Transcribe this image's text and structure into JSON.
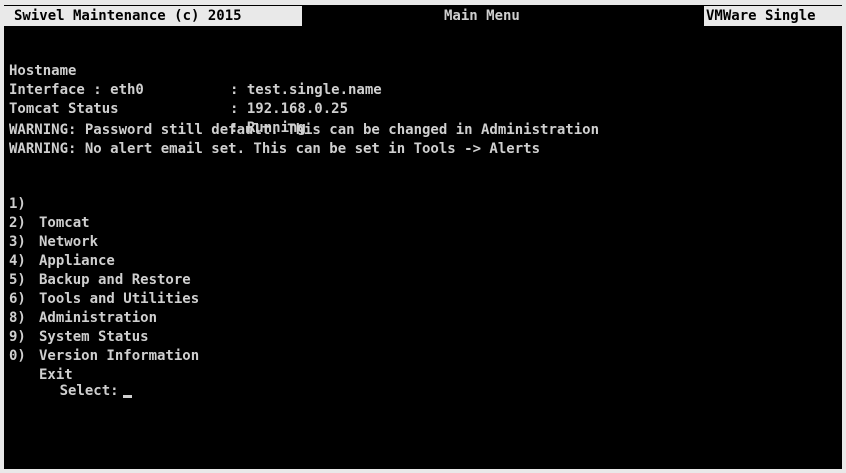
{
  "title_bar": {
    "left": "Swivel Maintenance (c) 2015",
    "center": "Main Menu",
    "right": "VMWare Single"
  },
  "info": [
    {
      "label": "Hostname",
      "value": ": test.single.name"
    },
    {
      "label": "Interface : eth0",
      "value": ": 192.168.0.25"
    },
    {
      "label": "Tomcat Status",
      "value": ": Running"
    }
  ],
  "warnings": [
    "WARNING: Password still default. This can be changed in Administration",
    "WARNING: No alert email set. This can be set in Tools -> Alerts"
  ],
  "menu": [
    {
      "num": "1)",
      "label": "Tomcat"
    },
    {
      "num": "2)",
      "label": "Network"
    },
    {
      "num": "3)",
      "label": "Appliance"
    },
    {
      "num": "4)",
      "label": "Backup and Restore"
    },
    {
      "num": "5)",
      "label": "Tools and Utilities"
    },
    {
      "num": "6)",
      "label": "Administration"
    },
    {
      "num": "8)",
      "label": "System Status"
    },
    {
      "num": "9)",
      "label": "Version Information"
    },
    {
      "num": "0)",
      "label": "Exit"
    }
  ],
  "prompt": {
    "label": "Select:"
  },
  "colors": {
    "background": "#000000",
    "text": "#cfcfcf",
    "inverse_bg": "#e9e9e9",
    "inverse_text": "#000000"
  }
}
